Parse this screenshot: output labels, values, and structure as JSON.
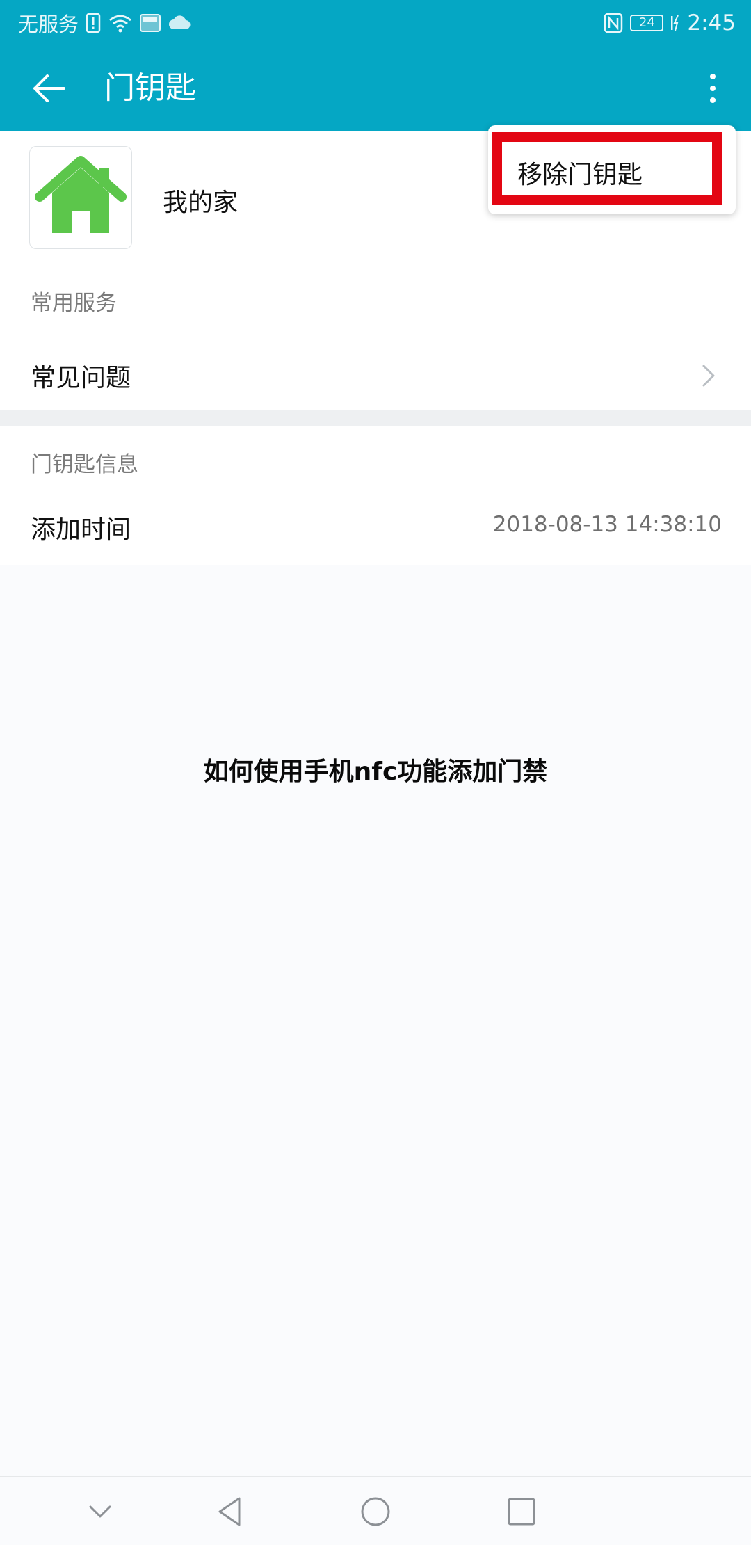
{
  "status_bar": {
    "carrier": "无服务",
    "battery": "24",
    "time": "2:45",
    "icon_color": "#e8f7fa"
  },
  "app_bar": {
    "title": "门钥匙",
    "background": "#05a7c4"
  },
  "key_card": {
    "name": "我的家",
    "icon": "house-icon",
    "icon_color": "#5cc64b"
  },
  "common_services": {
    "section_title": "常用服务",
    "items": [
      {
        "label": "常见问题"
      }
    ]
  },
  "key_info": {
    "section_title": "门钥匙信息",
    "added_time_label": "添加时间",
    "added_time_value": "2018-08-13 14:38:10"
  },
  "overflow_menu": {
    "items": [
      {
        "label": "移除门钥匙"
      }
    ],
    "highlight_color": "#e30613"
  },
  "caption": "如何使用手机nfc功能添加门禁"
}
